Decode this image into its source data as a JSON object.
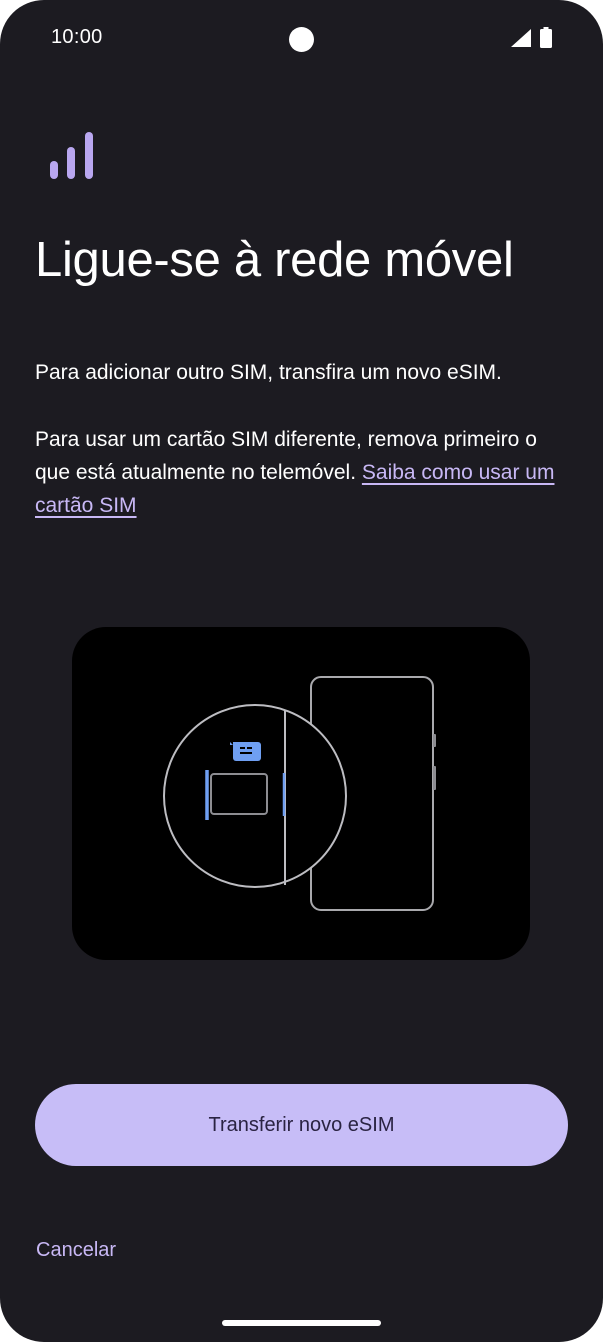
{
  "status_bar": {
    "time": "10:00",
    "icons": [
      "camera-cutout",
      "signal-icon",
      "battery-icon"
    ]
  },
  "header": {
    "icon": "signal-bars-icon",
    "title": "Ligue-se à rede móvel"
  },
  "body": {
    "paragraph_1": "Para adicionar outro SIM, transfira um novo eSIM.",
    "paragraph_2": "Para usar um cartão SIM diferente, remova primeiro o que está atualmente no telemóvel.",
    "link_label": "Saiba como usar um cartão SIM"
  },
  "illustration": {
    "name": "sim-tray-illustration",
    "icons": [
      "phone-outline",
      "sim-card-icon",
      "sim-tray"
    ]
  },
  "actions": {
    "primary_label": "Transferir novo eSIM",
    "cancel_label": "Cancelar"
  },
  "colors": {
    "background": "#1c1b21",
    "accent": "#c7bdf7",
    "link": "#c8b8f5",
    "illustration_blue": "#6f9ff2"
  }
}
